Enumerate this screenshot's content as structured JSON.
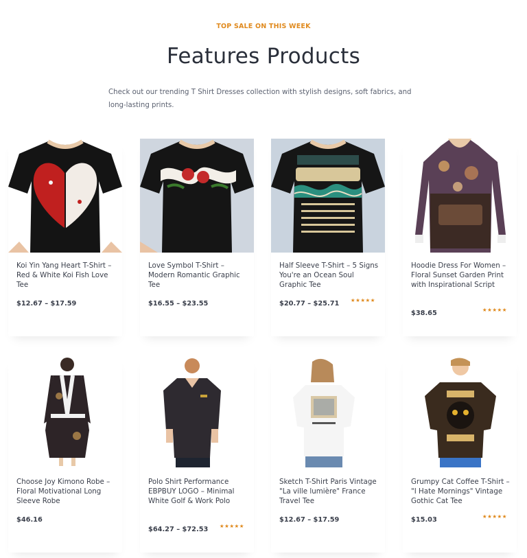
{
  "section": {
    "eyebrow": "TOP SALE ON THIS WEEK",
    "title": "Features Products",
    "subtitle": "Check out our trending T Shirt Dresses collection with stylish designs, soft fabrics, and long-lasting prints."
  },
  "products": [
    {
      "name": "Koi Yin Yang Heart T-Shirt – Red & White Koi Fish Love Tee",
      "price": "$12.67 – $17.59",
      "rating": "",
      "image": "koi-heart-tee"
    },
    {
      "name": "Love Symbol T-Shirt – Modern Romantic Graphic Tee",
      "price": "$16.55 – $23.55",
      "rating": "",
      "image": "love-symbol-tee"
    },
    {
      "name": "Half Sleeve T-Shirt – 5 Signs You're an Ocean Soul Graphic Tee",
      "price": "$20.77 – $25.71",
      "rating": "★★★★★",
      "image": "ocean-soul-tee"
    },
    {
      "name": "Hoodie Dress For Women – Floral Sunset Garden Print with Inspirational Script",
      "price": "$38.65",
      "rating": "★★★★★",
      "image": "floral-hoodie-dress"
    },
    {
      "name": "Choose Joy Kimono Robe – Floral Motivational Long Sleeve Robe",
      "price": "$46.16",
      "rating": "",
      "image": "kimono-robe"
    },
    {
      "name": "Polo Shirt Performance EBPBUY LOGO – Minimal White Golf & Work Polo",
      "price": "$64.27 – $72.53",
      "rating": "★★★★★",
      "image": "polo-shirt"
    },
    {
      "name": "Sketch T-Shirt Paris Vintage \"La ville lumière\" France Travel Tee",
      "price": "$12.67 – $17.59",
      "rating": "",
      "image": "paris-sketch-tee"
    },
    {
      "name": "Grumpy Cat Coffee T-Shirt – \"I Hate Mornings\" Vintage Gothic Cat Tee",
      "price": "$15.03",
      "rating": "★★★★★",
      "image": "grumpy-cat-tee"
    }
  ]
}
